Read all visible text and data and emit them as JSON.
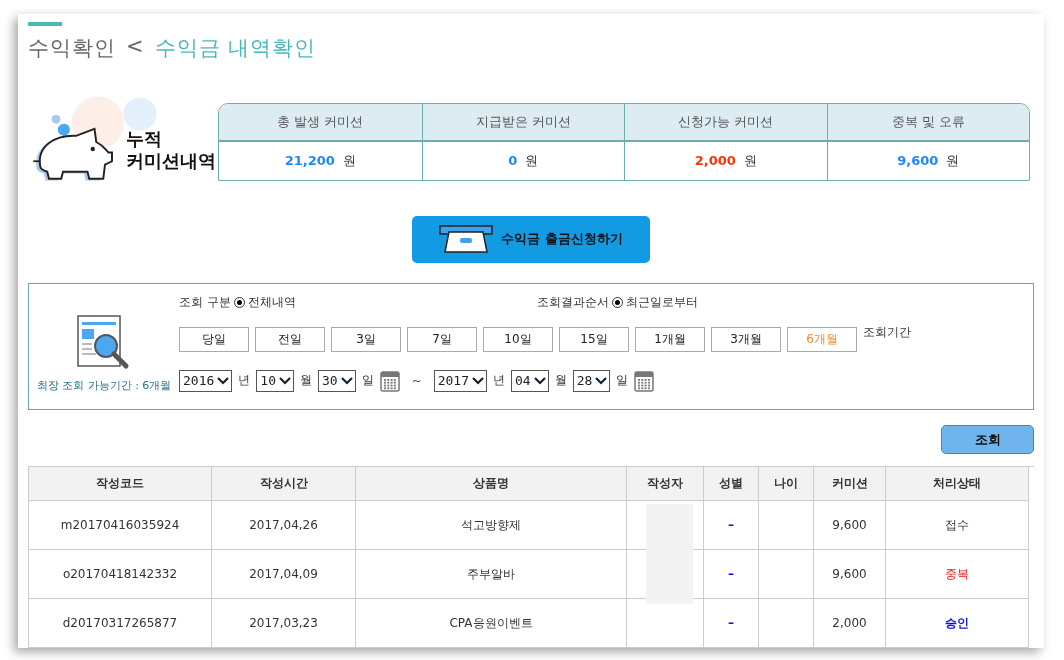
{
  "breadcrumb": {
    "parent": "수익확인",
    "separator": "<",
    "current": "수익금 내역확인"
  },
  "summary": {
    "label_line1": "누적",
    "label_line2": "커미션내역",
    "items": [
      {
        "label": "총 발생 커미션",
        "value": "21,200",
        "unit": "원",
        "color": "#1e88ff"
      },
      {
        "label": "지급받은 커미션",
        "value": "0",
        "unit": "원",
        "color": "#1e88ff"
      },
      {
        "label": "신청가능 커미션",
        "value": "2,000",
        "unit": "원",
        "color": "#ff3300"
      },
      {
        "label": "중복 및 오류",
        "value": "9,600",
        "unit": "원",
        "color": "#1e88ff"
      }
    ]
  },
  "withdraw_button": "수익금 출금신청하기",
  "search": {
    "max_period_note": "최장 조회 가능기간 : 6개월",
    "filters": [
      {
        "label": "조회 구분",
        "option": "전체내역",
        "checked": true
      },
      {
        "label": "조회결과순서",
        "option": "최근일로부터",
        "checked": true
      }
    ],
    "periods": [
      {
        "label": "당일",
        "selected": false
      },
      {
        "label": "전일",
        "selected": false
      },
      {
        "label": "3일",
        "selected": false
      },
      {
        "label": "7일",
        "selected": false
      },
      {
        "label": "10일",
        "selected": false
      },
      {
        "label": "15일",
        "selected": false
      },
      {
        "label": "1개월",
        "selected": false
      },
      {
        "label": "3개월",
        "selected": false
      },
      {
        "label": "6개월",
        "selected": true
      }
    ],
    "period_label": "조회기간",
    "from": [
      {
        "value": "2016",
        "unit": "년"
      },
      {
        "value": "10",
        "unit": "월"
      },
      {
        "value": "30",
        "unit": "일"
      }
    ],
    "tilde": "~",
    "to": [
      {
        "value": "2017",
        "unit": "년"
      },
      {
        "value": "04",
        "unit": "월"
      },
      {
        "value": "28",
        "unit": "일"
      }
    ],
    "button": "조회"
  },
  "table": {
    "columns": [
      "작성코드",
      "작성시간",
      "상품명",
      "작성자",
      "성별",
      "나이",
      "커미션",
      "처리상태"
    ],
    "rows": [
      {
        "code": "m20170416035924",
        "time": "2017,04,26",
        "product": "석고방향제",
        "gender": "–",
        "commission": "9,600",
        "status": {
          "text": "접수",
          "kind": "received"
        }
      },
      {
        "code": "o20170418142332",
        "time": "2017,04,09",
        "product": "주부알바",
        "gender": "–",
        "commission": "9,600",
        "status": {
          "text": "중복",
          "kind": "duplicate"
        }
      },
      {
        "code": "d20170317265877",
        "time": "2017,03,23",
        "product": "CPA응원이벤트",
        "gender": "–",
        "commission": "2,000",
        "status": {
          "text": "승인",
          "kind": "approved"
        }
      }
    ]
  }
}
